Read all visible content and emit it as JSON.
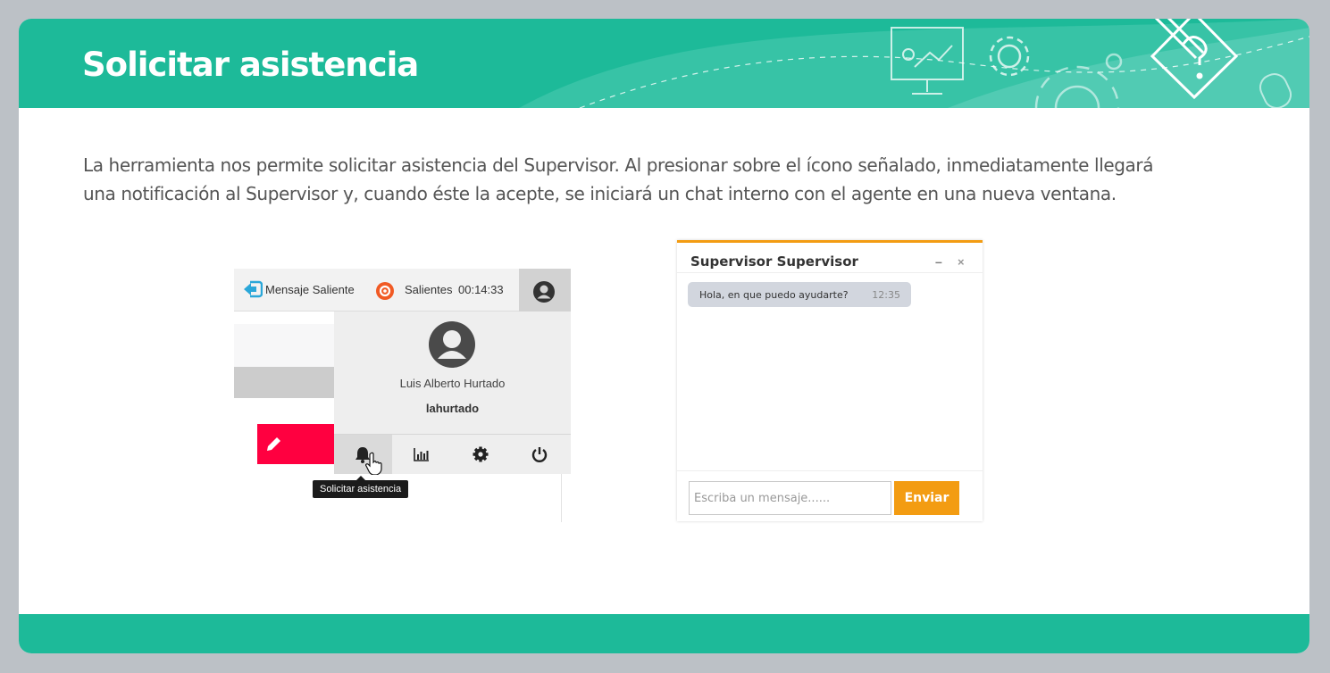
{
  "header": {
    "title": "Solicitar asistencia",
    "colors": {
      "accent": "#1dba99",
      "background": "#bcc1c6"
    },
    "decoration_icons": [
      "presentation-board-icon",
      "gear-icon",
      "large-gear-icon",
      "pencil-question-icon",
      "mouse-icon"
    ]
  },
  "description": "La herramienta nos permite solicitar asistencia del Supervisor. Al presionar sobre el ícono señalado, inmediatamente llegará una notificación al Supervisor y, cuando éste la acepte, se iniciará un chat interno con el agente en una nueva ventana.",
  "agent_screen": {
    "message_label": "Mensaje Saliente",
    "campaign_label": "Salientes",
    "timer": "00:14:33",
    "user_full_name": "Luis Alberto Hurtado",
    "username": "lahurtado",
    "actions": [
      "bell-icon",
      "bar-chart-icon",
      "gear-icon",
      "power-icon"
    ],
    "tooltip": "Solicitar asistencia",
    "colors": {
      "edit_button": "#ff0040",
      "message_icon": "#2aa7d9",
      "campaign_icon": "#f15a24"
    }
  },
  "chat": {
    "title": "Supervisor Supervisor",
    "minimize_icon": "–",
    "close_icon": "×",
    "message": "Hola, en que puedo ayudarte?",
    "message_time": "12:35",
    "input_placeholder": "Escriba un mensaje......",
    "send_label": "Enviar",
    "colors": {
      "accent": "#f39c12",
      "bubble": "#d2d6de"
    }
  }
}
